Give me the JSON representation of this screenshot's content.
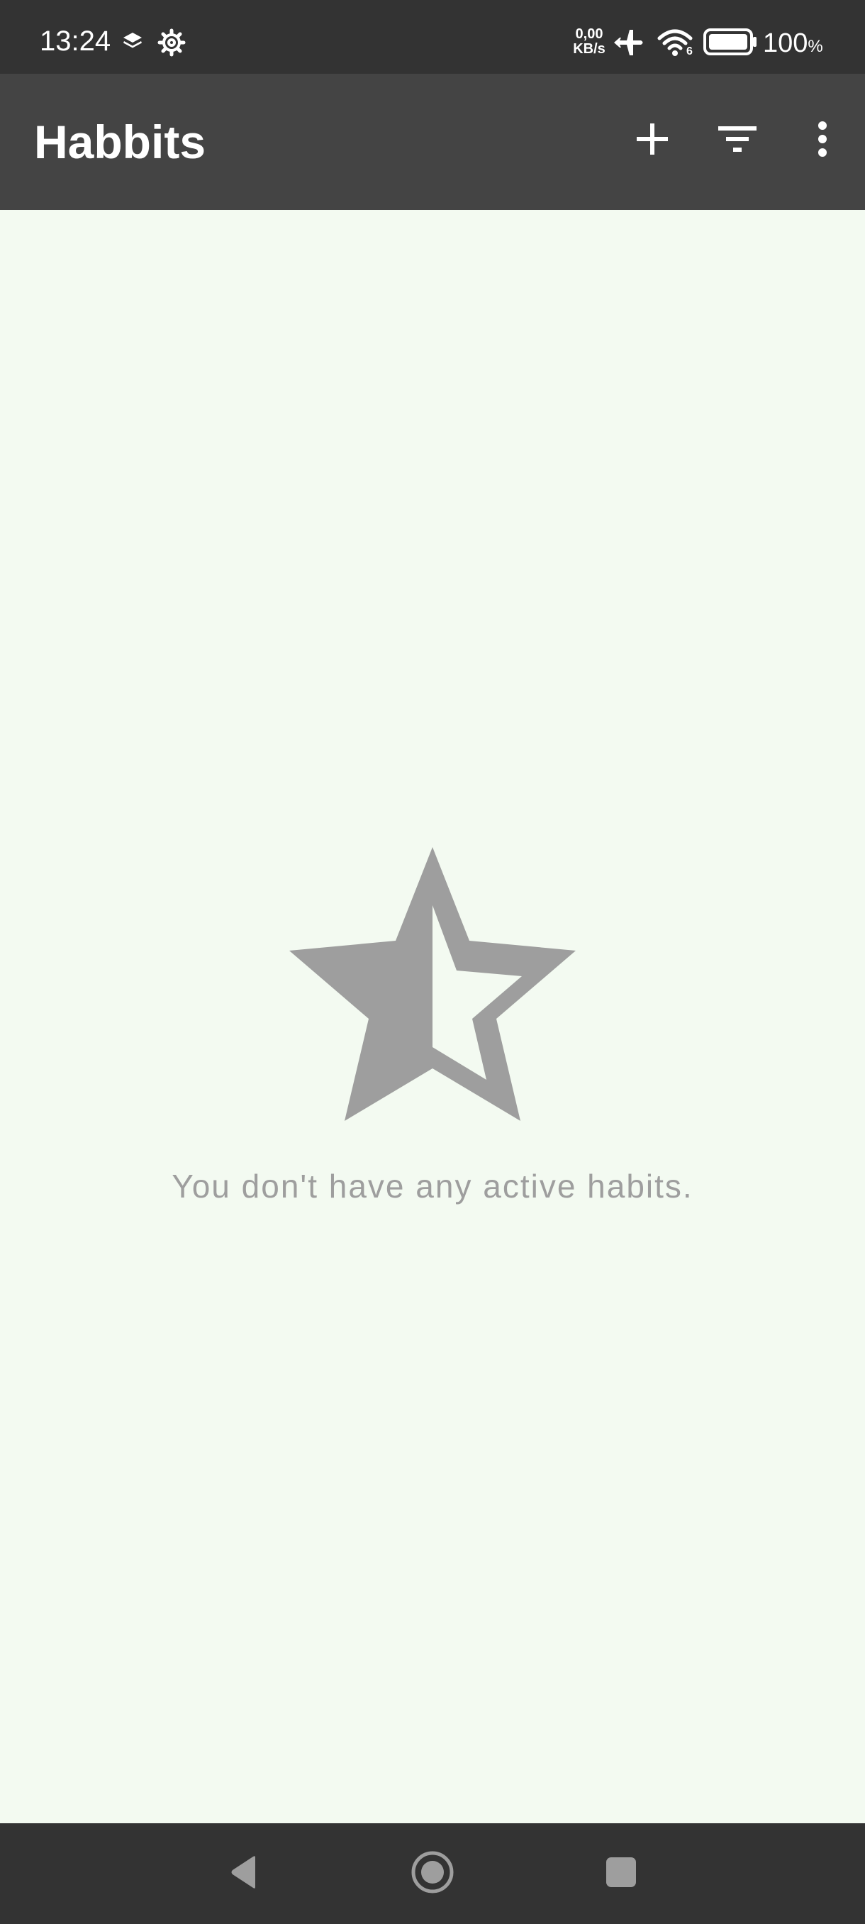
{
  "status_bar": {
    "time": "13:24",
    "net_speed_value": "0,00",
    "net_speed_unit": "KB/s",
    "wifi_badge": "6",
    "battery_percent": "100",
    "battery_percent_sign": "%",
    "icons": [
      "layers-icon",
      "gear-icon",
      "airplane-icon",
      "wifi-icon",
      "battery-icon"
    ]
  },
  "app_bar": {
    "title": "Habbits",
    "actions": [
      "add-icon",
      "filter-icon",
      "more-vert-icon"
    ]
  },
  "empty_state": {
    "icon": "star-half-icon",
    "message": "You don't have any active habits."
  },
  "nav_bar": {
    "buttons": [
      "back-icon",
      "home-icon",
      "recents-icon"
    ]
  },
  "colors": {
    "status_bar_bg": "#333333",
    "app_bar_bg": "#444444",
    "content_bg": "#f3faf1",
    "empty_gray": "#9e9e9e",
    "nav_bar_bg": "#333333"
  }
}
